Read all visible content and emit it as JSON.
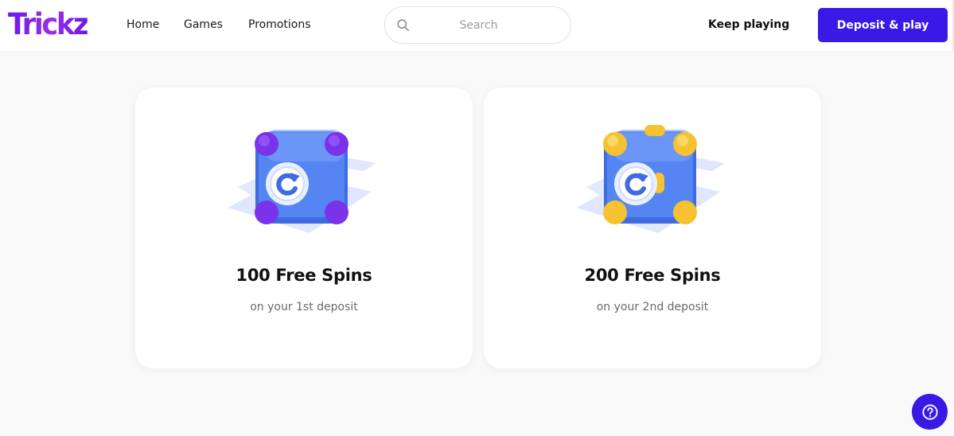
{
  "header": {
    "logo": "Trickz",
    "nav": [
      {
        "label": "Home"
      },
      {
        "label": "Games"
      },
      {
        "label": "Promotions"
      }
    ],
    "search": {
      "placeholder": "Search",
      "icon": "search-icon"
    },
    "keep_playing_label": "Keep playing",
    "deposit_label": "Deposit & play"
  },
  "bonuses": [
    {
      "title": "100 Free Spins",
      "subtitle": "on your 1st deposit",
      "accent": "#7a33e8",
      "icon": "free-spins-cube-icon"
    },
    {
      "title": "200 Free Spins",
      "subtitle": "on your 2nd deposit",
      "accent": "#f5c232",
      "icon": "free-spins-cube-icon"
    }
  ],
  "help": {
    "icon": "help-icon"
  },
  "colors": {
    "brand": "#3a18e6",
    "logo": "#6a19e6",
    "cube": "#4b7cf0",
    "background": "#f9f9fa"
  }
}
